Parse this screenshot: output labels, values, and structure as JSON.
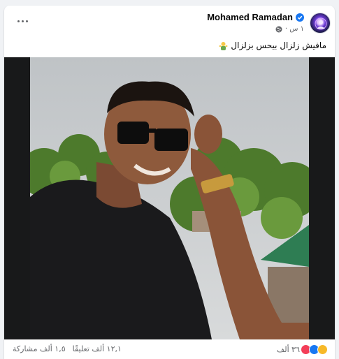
{
  "post": {
    "author": "Mohamed Ramadan",
    "time": "١ س ·",
    "text": "مافيش زلزال بيحس بزلزال",
    "emoji": "person-shrugging-icon"
  },
  "footer": {
    "reactions_count": "٣٦ ألف",
    "comments": "١٢,١ ألف تعليقًا",
    "shares": "١,٥ ألف مشاركة"
  },
  "colors": {
    "verified": "#1877f2",
    "love": "#f33e58",
    "like": "#1877f2",
    "haha": "#f7b928"
  }
}
